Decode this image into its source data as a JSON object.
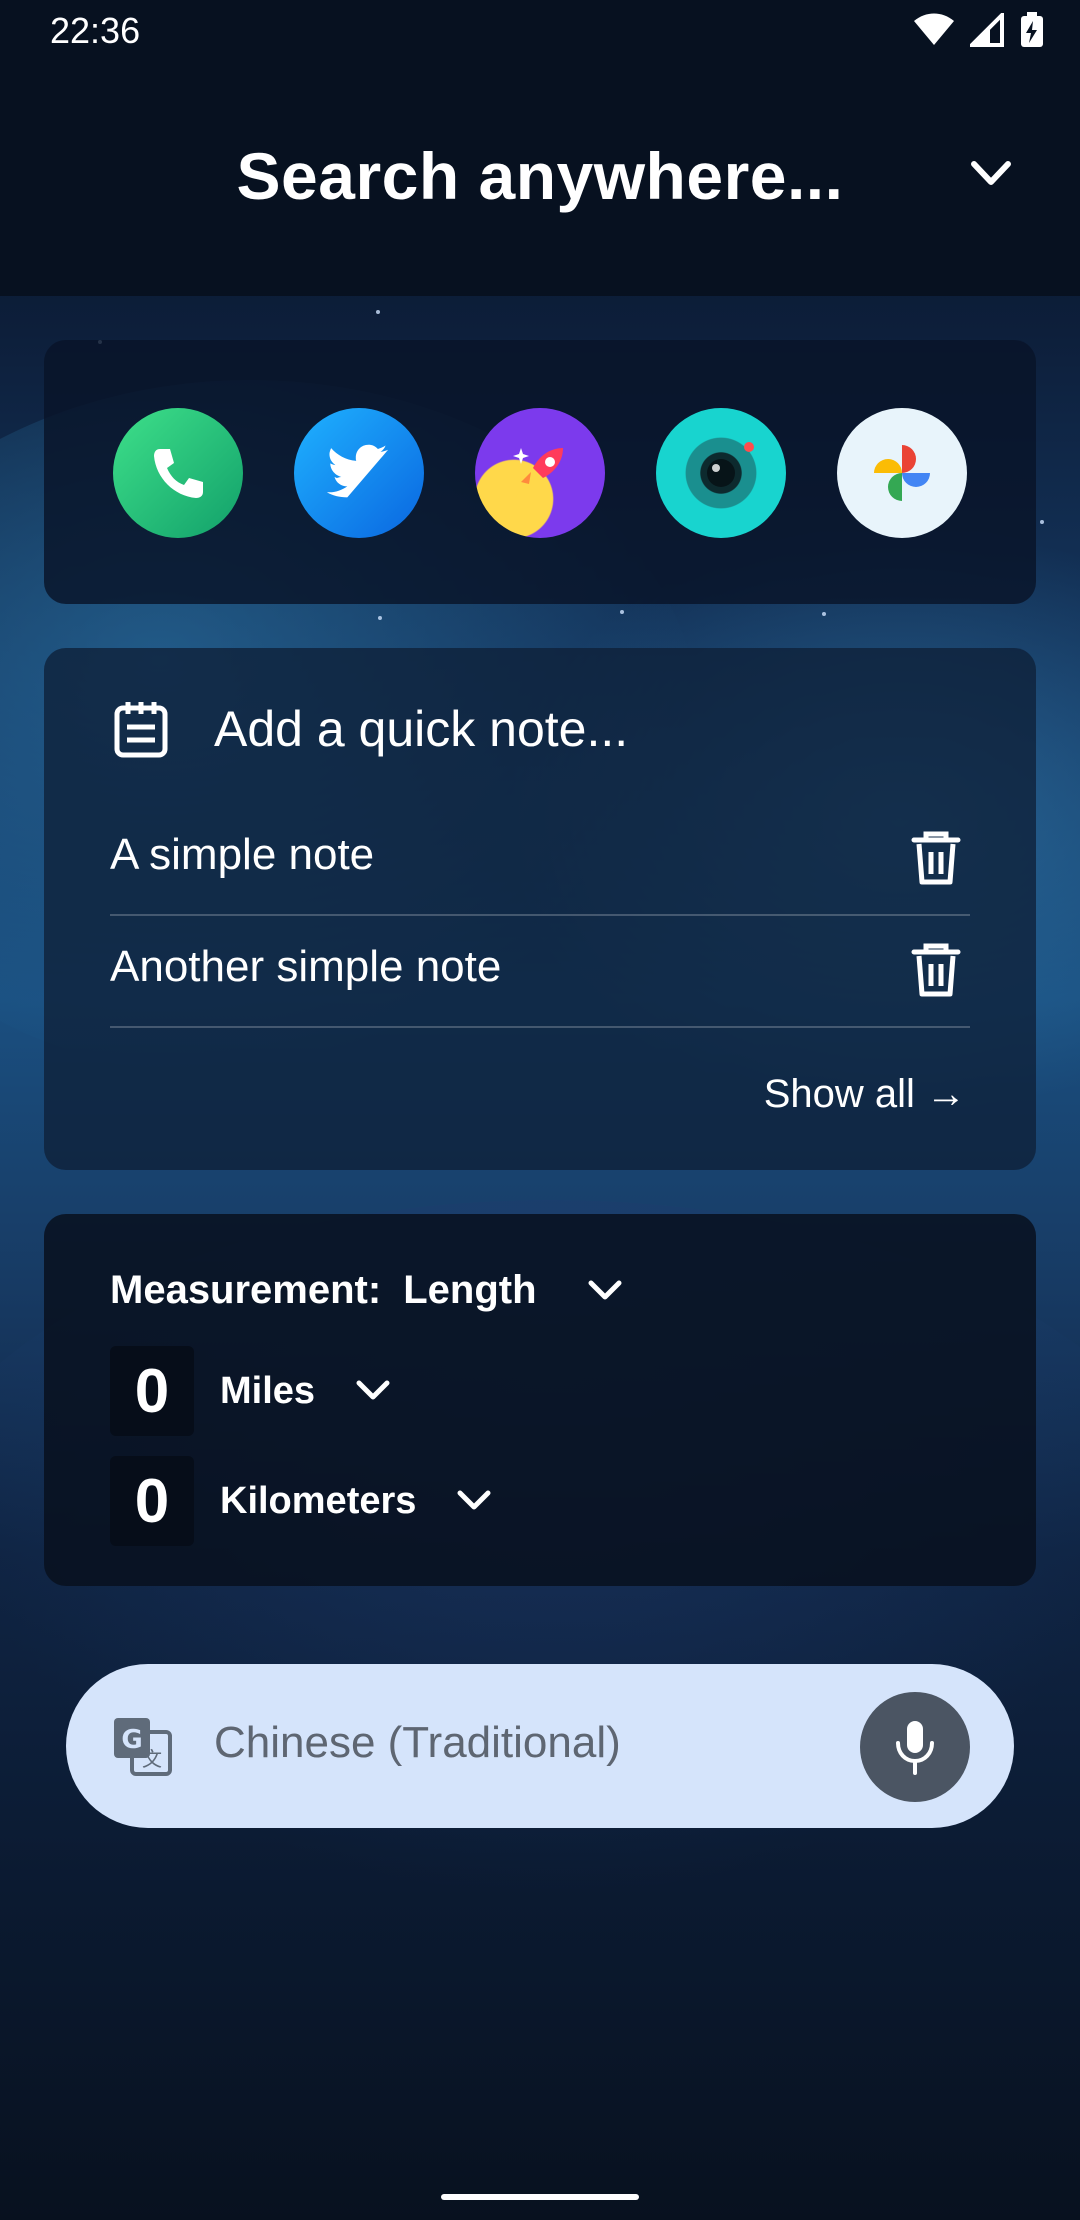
{
  "status_bar": {
    "time": "22:36",
    "icons": [
      "wifi-icon",
      "cell-signal-icon",
      "battery-charging-icon"
    ]
  },
  "header": {
    "title": "Search anywhere...",
    "collapse_icon": "chevron-down-icon"
  },
  "apps": [
    {
      "name": "Phone",
      "icon": "phone-icon",
      "color": "#1fae6a"
    },
    {
      "name": "Twitter",
      "icon": "twitter-icon",
      "color": "#1d9bf0"
    },
    {
      "name": "Rocket",
      "icon": "rocket-icon",
      "color": "#7c3aed"
    },
    {
      "name": "Camera",
      "icon": "camera-icon",
      "color": "#16c7c7"
    },
    {
      "name": "Photos",
      "icon": "pinwheel-icon",
      "color": "#e8f4fb"
    }
  ],
  "notes": {
    "add_label": "Add a quick note...",
    "items": [
      {
        "text": "A simple note"
      },
      {
        "text": "Another simple note"
      }
    ],
    "show_all": "Show all →"
  },
  "converter": {
    "label": "Measurement:",
    "measurement": "Length",
    "from": {
      "value": "0",
      "unit": "Miles"
    },
    "to": {
      "value": "0",
      "unit": "Kilometers"
    }
  },
  "translate": {
    "language": "Chinese (Traditional)",
    "mic_icon": "microphone-icon",
    "translate_icon": "google-translate-icon"
  },
  "colors": {
    "accent_pill": "#d5e4fb",
    "mic_bg": "#4b5563"
  }
}
